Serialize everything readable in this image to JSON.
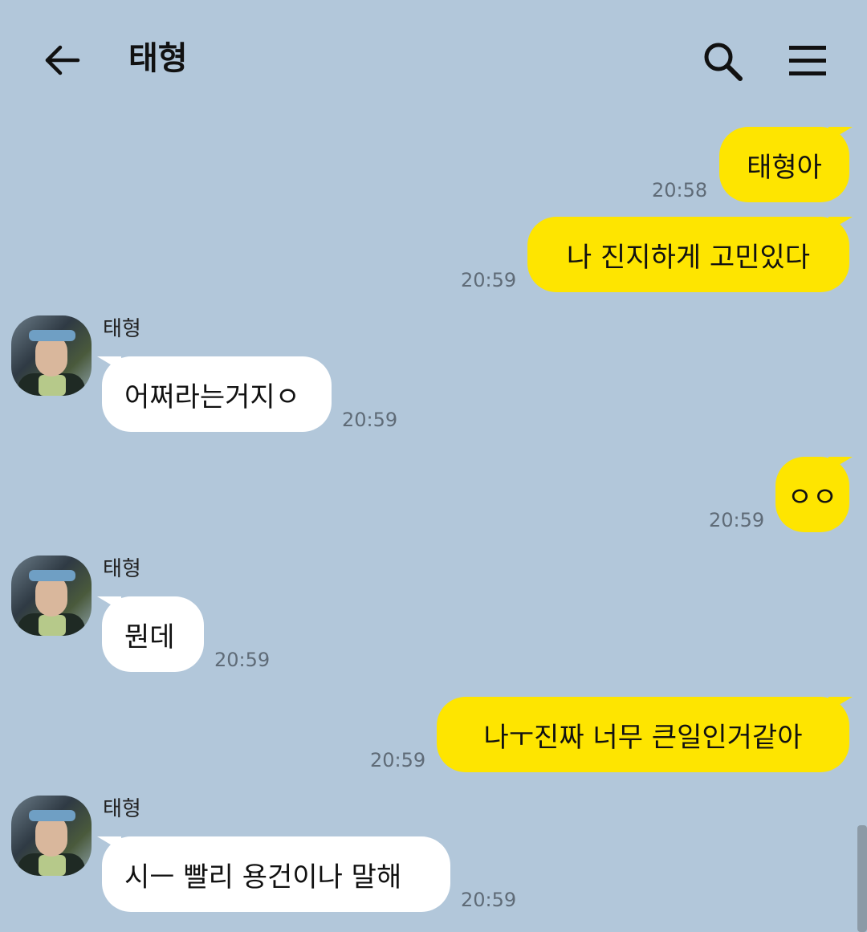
{
  "header": {
    "title": "태형",
    "back_icon": "arrow-left-icon",
    "search_icon": "search-icon",
    "menu_icon": "hamburger-menu-icon"
  },
  "colors": {
    "background": "#b2c7da",
    "my_bubble": "#fee500",
    "their_bubble": "#ffffff"
  },
  "messages": [
    {
      "from": "me",
      "text": "태형아",
      "time": "20:58"
    },
    {
      "from": "me",
      "text": "나 진지하게 고민있다",
      "time": "20:59"
    },
    {
      "from": "them",
      "sender": "태형",
      "text": "어쩌라는거지ㅇ",
      "time": "20:59"
    },
    {
      "from": "me",
      "text": "ㅇㅇ",
      "time": "20:59"
    },
    {
      "from": "them",
      "sender": "태형",
      "text": "뭔데",
      "time": "20:59"
    },
    {
      "from": "me",
      "text": "나ㅜ진짜 너무 큰일인거같아",
      "time": "20:59"
    },
    {
      "from": "them",
      "sender": "태형",
      "text": "시ㅡ 빨리 용건이나 말해",
      "time": "20:59"
    }
  ]
}
